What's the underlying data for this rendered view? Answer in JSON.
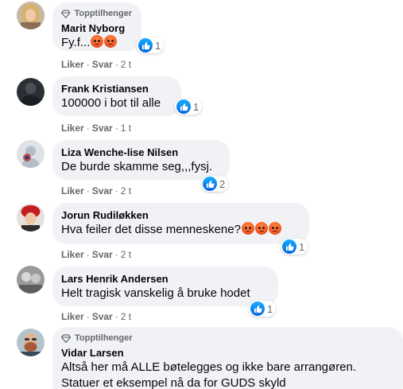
{
  "comments": [
    {
      "badge": "Topptilhenger",
      "author": "Marit Nyborg",
      "text": "Fy.f...",
      "angry_emojis": 2,
      "reaction_count": "1",
      "like": "Liker",
      "reply": "Svar",
      "time": "2 t",
      "avatar": "woman-blonde-avatar"
    },
    {
      "badge": "",
      "author": "Frank Kristiansen",
      "text": "100000 i bot til alle",
      "angry_emojis": 0,
      "reaction_count": "1",
      "like": "Liker",
      "reply": "Svar",
      "time": "1 t",
      "avatar": "dark-avatar"
    },
    {
      "badge": "",
      "author": "Liza Wenche-lise Nilsen",
      "text": "De burde skamme seg,,,fysj.",
      "angry_emojis": 0,
      "reaction_count": "2",
      "like": "Liker",
      "reply": "Svar",
      "time": "2 t",
      "avatar": "default-avatar"
    },
    {
      "badge": "",
      "author": "Jorun Rudiløkken",
      "text": "Hva feiler det disse menneskene?",
      "angry_emojis": 3,
      "reaction_count": "1",
      "like": "Liker",
      "reply": "Svar",
      "time": "2 t",
      "avatar": "woman-red-hat-avatar"
    },
    {
      "badge": "",
      "author": "Lars Henrik Andersen",
      "text": "Helt tragisk vanskelig å bruke hodet",
      "angry_emojis": 0,
      "reaction_count": "1",
      "like": "Liker",
      "reply": "Svar",
      "time": "2 t",
      "avatar": "grey-photo-avatar"
    },
    {
      "badge": "Topptilhenger",
      "author": "Vidar Larsen",
      "text_line1": "Altså her må ALLE bøtelegges og ikke bare arrangøren.",
      "text_line2": "Statuer et eksempel nå da for GUDS skyld",
      "avatar": "bearded-man-avatar"
    }
  ],
  "colors": {
    "bubble": "#f0f2f5",
    "meta": "#65676b",
    "like_blue": "#1877f2",
    "angry": "#f25c2a"
  }
}
